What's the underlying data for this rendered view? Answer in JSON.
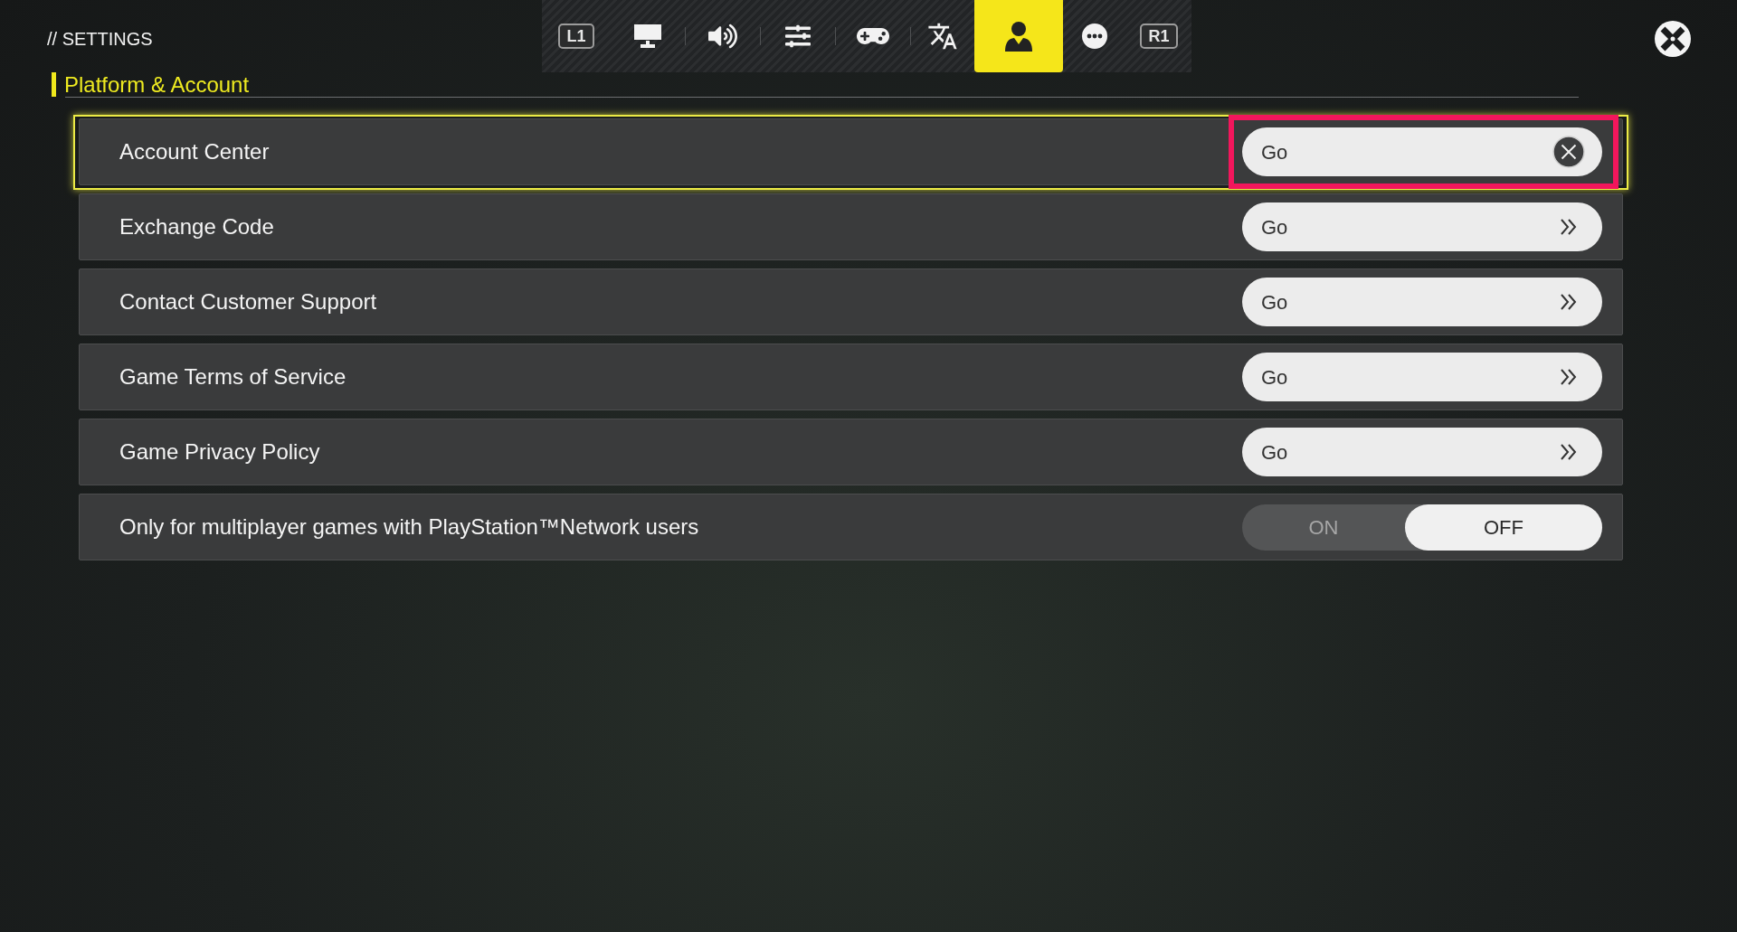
{
  "header": {
    "breadcrumb": "// SETTINGS"
  },
  "tab_bar": {
    "prev_key": "L1",
    "next_key": "R1",
    "tabs": [
      {
        "selected": false
      },
      {
        "selected": false
      },
      {
        "selected": false
      },
      {
        "selected": false
      },
      {
        "selected": false
      },
      {
        "selected": true
      },
      {
        "selected": false
      }
    ]
  },
  "section": {
    "title": "Platform & Account"
  },
  "rows": [
    {
      "kind": "link",
      "label": "Account Center",
      "selected": true,
      "action": "Go"
    },
    {
      "kind": "link",
      "label": "Exchange Code",
      "selected": false,
      "action": "Go"
    },
    {
      "kind": "link",
      "label": "Contact Customer Support",
      "selected": false,
      "action": "Go"
    },
    {
      "kind": "link",
      "label": "Game Terms of Service",
      "selected": false,
      "action": "Go"
    },
    {
      "kind": "link",
      "label": "Game Privacy Policy",
      "selected": false,
      "action": "Go"
    },
    {
      "kind": "toggle",
      "label": "Only for multiplayer games with PlayStation™Network users",
      "selected": false,
      "options": [
        {
          "label": "ON",
          "selected": false
        },
        {
          "label": "OFF",
          "selected": true
        }
      ]
    }
  ]
}
